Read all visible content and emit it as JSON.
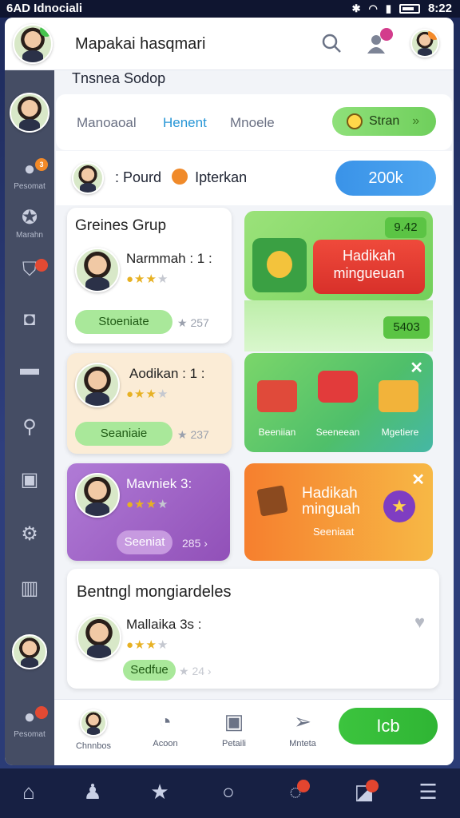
{
  "status": {
    "left": "6AD Idnociali",
    "time": "8:22"
  },
  "header": {
    "title": "Mapakai hasqmari",
    "avatar_badge": "",
    "notif_badge": "",
    "profile_badge": ""
  },
  "sidebar": {
    "items": [
      {
        "label": "",
        "icon": "avatar"
      },
      {
        "label": "Pesomat",
        "icon": "user-icon",
        "badge": "3"
      },
      {
        "label": "Marahn",
        "icon": "star-icon"
      },
      {
        "label": "",
        "icon": "shield-icon"
      },
      {
        "label": "",
        "icon": "camera-icon"
      },
      {
        "label": "",
        "icon": "tv-icon"
      },
      {
        "label": "",
        "icon": "search-icon"
      },
      {
        "label": "",
        "icon": "box-icon"
      },
      {
        "label": "",
        "icon": "gear-icon"
      },
      {
        "label": "",
        "icon": "bars-icon"
      },
      {
        "label": "",
        "icon": "avatar"
      },
      {
        "label": "Pesomat",
        "icon": "user-icon"
      }
    ]
  },
  "section_title": "Tnsnea Sodop",
  "tabs": {
    "items": [
      "Manoaoal",
      "Henent",
      "Mnoele"
    ],
    "active": 1,
    "search_label": "Stran",
    "search_chev": "»"
  },
  "userbar": {
    "text": ": Pourd",
    "text2": "Ipterkan",
    "count": "200k"
  },
  "cards": [
    {
      "title": "Greines Grup",
      "name": "Narmmah : 1 :",
      "pill": "Stoeniate",
      "meta": "★ 257",
      "stars": 3
    },
    {
      "name": "Aodikan : 1 :",
      "pill": "Seaniaie",
      "meta": "★ 237",
      "stars": 3
    },
    {
      "name": "Mavniek 3:",
      "pill": "Seeniat",
      "meta": "285 ›",
      "stars": 3
    }
  ],
  "promos": {
    "p1": {
      "badge_top": "9.42",
      "btn": "Hadikah mingueuan",
      "badge_bottom": "5403"
    },
    "p2": {
      "labels": [
        "Beeniian",
        "Seeneean",
        "Mgetiere"
      ]
    },
    "p3": {
      "title": "Hadikah minguah",
      "sub": "Seeniaat"
    }
  },
  "bottom_card": {
    "title": "Bentngl mongiardeles",
    "name": "Mallaika 3s :",
    "pill": "Sedfue",
    "meta": "★ 24 ›",
    "stars": 3
  },
  "bottom_nav": {
    "items": [
      "Chnnbos",
      "Acoon",
      "Petaili",
      "Mnteta"
    ],
    "cta": "Icb"
  },
  "colors": {
    "accent": "#2796d6",
    "green": "#5bc444",
    "purple": "#a35fc5",
    "orange": "#f4953a",
    "red": "#e23b30"
  }
}
